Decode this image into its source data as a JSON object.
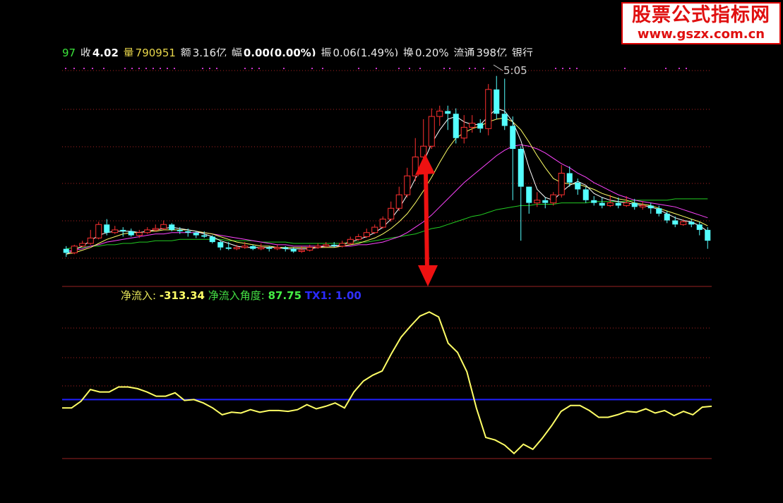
{
  "quote_bar": {
    "items": [
      {
        "text": "97",
        "cls": "q-green"
      },
      {
        "text": " 收",
        "cls": "q-white"
      },
      {
        "text": "4.02",
        "cls": "q-num"
      },
      {
        "text": " 量",
        "cls": "q-yellow"
      },
      {
        "text": "790951",
        "cls": "q-yellow"
      },
      {
        "text": " 额",
        "cls": "q-white"
      },
      {
        "text": "3.16亿",
        "cls": "q-white"
      },
      {
        "text": " 幅",
        "cls": "q-white"
      },
      {
        "text": "0.00(0.00%)",
        "cls": "q-num"
      },
      {
        "text": " 振",
        "cls": "q-white"
      },
      {
        "text": "0.06(1.49%)",
        "cls": "q-white"
      },
      {
        "text": " 换",
        "cls": "q-white"
      },
      {
        "text": "0.20%",
        "cls": "q-white"
      },
      {
        "text": " 流通",
        "cls": "q-white"
      },
      {
        "text": "398亿",
        "cls": "q-white"
      },
      {
        "text": " 银行",
        "cls": "q-white"
      }
    ]
  },
  "time_label": "5:05",
  "watermark": {
    "title": "股票公式指标网",
    "url": "www.gszx.com.cn"
  },
  "indicator_legend": {
    "net_inflow_label": "净流入:",
    "net_inflow_value": "-313.34",
    "angle_label": "净流入角度:",
    "angle_value": "87.75",
    "tx1_label": "TX1:",
    "tx1_value": "1.00"
  },
  "colors": {
    "up_candle": "#ff3030",
    "down_candle": "#54ffff",
    "ma_white": "#ffffff",
    "ma_yellow": "#ffff66",
    "ma_magenta": "#ff44ff",
    "ma_green": "#22cc22",
    "grid_dot": "#aa2222",
    "indicator_line": "#ffff66",
    "tx1_line": "#2020ff",
    "arrow": "#ee1111"
  },
  "chart_data": [
    {
      "type": "candlestick",
      "candles": [
        [
          3.64,
          3.61,
          3.66,
          3.58
        ],
        [
          3.61,
          3.66,
          3.67,
          3.6
        ],
        [
          3.66,
          3.68,
          3.7,
          3.65
        ],
        [
          3.68,
          3.72,
          3.78,
          3.67
        ],
        [
          3.72,
          3.82,
          3.84,
          3.71
        ],
        [
          3.82,
          3.76,
          3.86,
          3.74
        ],
        [
          3.76,
          3.78,
          3.81,
          3.75
        ],
        [
          3.78,
          3.77,
          3.8,
          3.73
        ],
        [
          3.77,
          3.74,
          3.79,
          3.73
        ],
        [
          3.74,
          3.76,
          3.78,
          3.72
        ],
        [
          3.76,
          3.78,
          3.8,
          3.75
        ],
        [
          3.78,
          3.79,
          3.82,
          3.77
        ],
        [
          3.79,
          3.82,
          3.85,
          3.78
        ],
        [
          3.82,
          3.78,
          3.83,
          3.77
        ],
        [
          3.78,
          3.77,
          3.8,
          3.75
        ],
        [
          3.77,
          3.76,
          3.79,
          3.73
        ],
        [
          3.76,
          3.74,
          3.77,
          3.72
        ],
        [
          3.74,
          3.73,
          3.77,
          3.72
        ],
        [
          3.73,
          3.69,
          3.74,
          3.68
        ],
        [
          3.69,
          3.65,
          3.7,
          3.63
        ],
        [
          3.65,
          3.64,
          3.69,
          3.63
        ],
        [
          3.64,
          3.65,
          3.67,
          3.63
        ],
        [
          3.65,
          3.66,
          3.69,
          3.64
        ],
        [
          3.66,
          3.64,
          3.67,
          3.63
        ],
        [
          3.64,
          3.65,
          3.68,
          3.63
        ],
        [
          3.65,
          3.64,
          3.66,
          3.62
        ],
        [
          3.64,
          3.65,
          3.67,
          3.63
        ],
        [
          3.65,
          3.64,
          3.66,
          3.62
        ],
        [
          3.64,
          3.62,
          3.65,
          3.61
        ],
        [
          3.62,
          3.63,
          3.66,
          3.61
        ],
        [
          3.63,
          3.65,
          3.67,
          3.62
        ],
        [
          3.65,
          3.66,
          3.68,
          3.64
        ],
        [
          3.66,
          3.67,
          3.69,
          3.65
        ],
        [
          3.67,
          3.66,
          3.69,
          3.65
        ],
        [
          3.66,
          3.68,
          3.7,
          3.65
        ],
        [
          3.68,
          3.71,
          3.73,
          3.67
        ],
        [
          3.71,
          3.73,
          3.75,
          3.7
        ],
        [
          3.73,
          3.76,
          3.79,
          3.72
        ],
        [
          3.76,
          3.8,
          3.82,
          3.75
        ],
        [
          3.8,
          3.86,
          3.88,
          3.79
        ],
        [
          3.86,
          3.94,
          3.99,
          3.84
        ],
        [
          3.94,
          4.04,
          4.1,
          3.92
        ],
        [
          4.04,
          4.18,
          4.24,
          4.02
        ],
        [
          4.18,
          4.32,
          4.46,
          4.14
        ],
        [
          4.32,
          4.4,
          4.6,
          4.28
        ],
        [
          4.4,
          4.62,
          4.68,
          4.38
        ],
        [
          4.62,
          4.66,
          4.7,
          4.55
        ],
        [
          4.66,
          4.64,
          4.7,
          4.52
        ],
        [
          4.64,
          4.46,
          4.68,
          4.42
        ],
        [
          4.46,
          4.54,
          4.63,
          4.42
        ],
        [
          4.54,
          4.57,
          4.63,
          4.5
        ],
        [
          4.57,
          4.53,
          4.6,
          4.5
        ],
        [
          4.53,
          4.82,
          4.86,
          4.48
        ],
        [
          4.82,
          4.64,
          4.92,
          4.6
        ],
        [
          4.64,
          4.55,
          4.9,
          4.52
        ],
        [
          4.55,
          4.38,
          4.62,
          4.0
        ],
        [
          4.38,
          4.1,
          4.4,
          3.7
        ],
        [
          4.1,
          3.98,
          4.06,
          3.9
        ],
        [
          3.98,
          4.0,
          4.06,
          3.95
        ],
        [
          4.0,
          3.98,
          4.02,
          3.94
        ],
        [
          3.98,
          4.04,
          4.06,
          3.96
        ],
        [
          4.04,
          4.2,
          4.26,
          4.02
        ],
        [
          4.2,
          4.13,
          4.25,
          4.1
        ],
        [
          4.13,
          4.08,
          4.16,
          4.04
        ],
        [
          4.08,
          4.0,
          4.1,
          3.98
        ],
        [
          4.0,
          3.98,
          4.03,
          3.96
        ],
        [
          3.98,
          3.96,
          4.02,
          3.94
        ],
        [
          3.96,
          3.98,
          4.04,
          3.95
        ],
        [
          3.98,
          3.96,
          4.02,
          3.94
        ],
        [
          3.96,
          3.98,
          4.03,
          3.95
        ],
        [
          3.98,
          3.95,
          4.01,
          3.93
        ],
        [
          3.95,
          3.96,
          3.99,
          3.93
        ],
        [
          3.96,
          3.94,
          3.98,
          3.9
        ],
        [
          3.94,
          3.9,
          3.96,
          3.88
        ],
        [
          3.9,
          3.85,
          3.92,
          3.83
        ],
        [
          3.85,
          3.82,
          3.88,
          3.8
        ],
        [
          3.82,
          3.84,
          3.86,
          3.81
        ],
        [
          3.84,
          3.82,
          3.86,
          3.8
        ],
        [
          3.82,
          3.78,
          3.84,
          3.74
        ],
        [
          3.78,
          3.7,
          3.8,
          3.64
        ]
      ],
      "ma_short": [
        3.6,
        3.63,
        3.66,
        3.7,
        3.74,
        3.76,
        3.77,
        3.77,
        3.77,
        3.76,
        3.77,
        3.78,
        3.79,
        3.8,
        3.79,
        3.78,
        3.77,
        3.75,
        3.73,
        3.7,
        3.68,
        3.66,
        3.65,
        3.65,
        3.65,
        3.65,
        3.65,
        3.64,
        3.64,
        3.64,
        3.64,
        3.65,
        3.66,
        3.66,
        3.67,
        3.69,
        3.71,
        3.73,
        3.76,
        3.8,
        3.86,
        3.94,
        4.04,
        4.16,
        4.28,
        4.42,
        4.52,
        4.6,
        4.62,
        4.58,
        4.56,
        4.56,
        4.62,
        4.68,
        4.66,
        4.58,
        4.44,
        4.24,
        4.08,
        4.02,
        4.0,
        4.06,
        4.11,
        4.14,
        4.11,
        4.05,
        4.02,
        4.0,
        3.99,
        3.98,
        3.97,
        3.96,
        3.95,
        3.93,
        3.9,
        3.87,
        3.85,
        3.84,
        3.81,
        3.77
      ],
      "ma_mid": [
        3.6,
        3.61,
        3.63,
        3.65,
        3.68,
        3.71,
        3.73,
        3.75,
        3.76,
        3.76,
        3.77,
        3.77,
        3.78,
        3.78,
        3.78,
        3.78,
        3.77,
        3.76,
        3.75,
        3.73,
        3.71,
        3.69,
        3.68,
        3.67,
        3.66,
        3.66,
        3.65,
        3.65,
        3.65,
        3.65,
        3.65,
        3.65,
        3.65,
        3.65,
        3.66,
        3.67,
        3.68,
        3.7,
        3.72,
        3.75,
        3.79,
        3.84,
        3.9,
        3.98,
        4.07,
        4.17,
        4.28,
        4.38,
        4.46,
        4.5,
        4.53,
        4.55,
        4.58,
        4.6,
        4.61,
        4.58,
        4.52,
        4.43,
        4.33,
        4.24,
        4.16,
        4.13,
        4.12,
        4.12,
        4.1,
        4.08,
        4.05,
        4.03,
        4.01,
        4.0,
        3.98,
        3.97,
        3.96,
        3.94,
        3.92,
        3.9,
        3.88,
        3.86,
        3.84,
        3.81
      ],
      "ma_long": [
        3.62,
        3.63,
        3.64,
        3.66,
        3.67,
        3.69,
        3.7,
        3.71,
        3.72,
        3.73,
        3.74,
        3.75,
        3.75,
        3.76,
        3.76,
        3.76,
        3.76,
        3.76,
        3.75,
        3.74,
        3.73,
        3.72,
        3.71,
        3.7,
        3.69,
        3.68,
        3.67,
        3.67,
        3.66,
        3.66,
        3.66,
        3.66,
        3.66,
        3.66,
        3.66,
        3.66,
        3.67,
        3.67,
        3.68,
        3.69,
        3.71,
        3.73,
        3.76,
        3.8,
        3.84,
        3.89,
        3.95,
        4.01,
        4.07,
        4.13,
        4.18,
        4.23,
        4.28,
        4.33,
        4.37,
        4.4,
        4.41,
        4.4,
        4.38,
        4.35,
        4.31,
        4.27,
        4.24,
        4.2,
        4.17,
        4.13,
        4.1,
        4.07,
        4.04,
        4.02,
        4.0,
        3.99,
        3.98,
        3.97,
        3.96,
        3.95,
        3.93,
        3.91,
        3.89,
        3.87
      ],
      "ma_longest": [
        3.64,
        3.65,
        3.65,
        3.66,
        3.66,
        3.67,
        3.67,
        3.68,
        3.68,
        3.69,
        3.69,
        3.7,
        3.7,
        3.7,
        3.71,
        3.71,
        3.71,
        3.71,
        3.71,
        3.71,
        3.7,
        3.7,
        3.7,
        3.7,
        3.69,
        3.69,
        3.69,
        3.69,
        3.68,
        3.68,
        3.68,
        3.68,
        3.68,
        3.68,
        3.68,
        3.69,
        3.69,
        3.69,
        3.7,
        3.71,
        3.72,
        3.73,
        3.74,
        3.75,
        3.77,
        3.79,
        3.8,
        3.82,
        3.84,
        3.86,
        3.88,
        3.89,
        3.91,
        3.93,
        3.94,
        3.95,
        3.96,
        3.96,
        3.97,
        3.97,
        3.97,
        3.98,
        3.98,
        3.98,
        3.98,
        3.99,
        3.99,
        3.99,
        3.99,
        3.99,
        4.0,
        4.0,
        4.0,
        4.0,
        4.0,
        4.01,
        4.01,
        4.01,
        4.01,
        4.01
      ]
    },
    {
      "type": "line",
      "series": [
        {
          "name": "净流入",
          "values": [
            0.0,
            0.0,
            0.8,
            2.2,
            1.9,
            1.9,
            2.5,
            2.5,
            2.3,
            1.9,
            1.4,
            1.4,
            1.8,
            0.9,
            1.0,
            0.6,
            0.0,
            -0.8,
            -0.5,
            -0.6,
            -0.2,
            -0.5,
            -0.3,
            -0.3,
            -0.4,
            -0.2,
            0.4,
            -0.1,
            0.2,
            0.6,
            0.0,
            1.9,
            3.2,
            3.9,
            4.4,
            6.5,
            8.4,
            9.7,
            10.9,
            11.4,
            10.8,
            7.7,
            6.6,
            4.3,
            0.0,
            -3.5,
            -3.8,
            -4.4,
            -5.4,
            -4.3,
            -4.9,
            -3.6,
            -2.1,
            -0.4,
            0.3,
            0.3,
            -0.3,
            -1.1,
            -1.1,
            -0.8,
            -0.4,
            -0.5,
            -0.1,
            -0.6,
            -0.3,
            -0.9,
            -0.4,
            -0.8,
            0.1,
            0.2
          ]
        },
        {
          "name": "TX1",
          "values": [
            1.0,
            1.0
          ]
        }
      ]
    }
  ]
}
